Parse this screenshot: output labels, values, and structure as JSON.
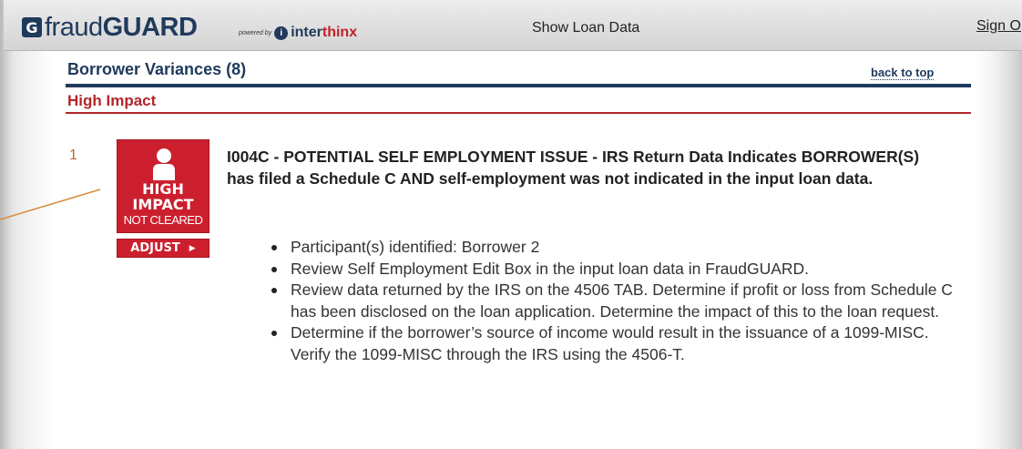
{
  "header": {
    "logo_mark": "G",
    "logo_fraud": "fraud",
    "logo_guard": "GUARD",
    "powered_by": "powered by",
    "inter_icon": "i",
    "inter_text": "inter",
    "thinx_text": "thinx",
    "show_loan_data": "Show Loan Data",
    "sign_out": "Sign O"
  },
  "section": {
    "title": "Borrower Variances (8)",
    "back_to_top": "back to top",
    "impact_heading": "High Impact"
  },
  "item": {
    "number": "1",
    "badge": {
      "line1": "HIGH",
      "line2": "IMPACT",
      "status": "NOT CLEARED",
      "icon": "person-icon"
    },
    "adjust_label": "ADJUST",
    "adjust_icon": "▶",
    "heading": "I004C - POTENTIAL SELF EMPLOYMENT ISSUE - IRS Return Data Indicates BORROWER(S) has filed a Schedule C AND self-employment was not indicated in the input loan data.",
    "bullets": [
      "Participant(s) identified: Borrower 2",
      "Review Self Employment Edit Box in the input loan data in FraudGUARD.",
      "Review data returned by the IRS on the 4506 TAB. Determine if profit or loss from Schedule C has been disclosed on the loan application. Determine the impact of this to the loan request.",
      "Determine if the borrower’s source of income would result in the issuance of a 1099-MISC. Verify the 1099-MISC through the IRS using the 4506-T."
    ]
  },
  "colors": {
    "navy": "#1f3a5c",
    "red": "#cc1f2d",
    "impact_red": "#b3262a",
    "callout_line": "#d98b3a"
  }
}
